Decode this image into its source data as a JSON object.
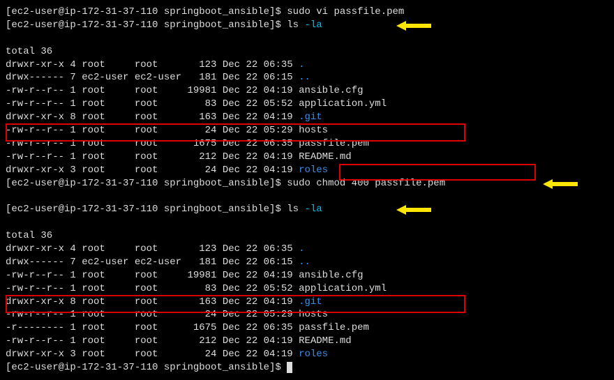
{
  "prompt_prefix": "[ec2-user@ip-172-31-37-110 springboot_ansible]$ ",
  "cmd1": "sudo vi passfile.pem",
  "cmd2_a": "ls ",
  "cmd2_b": "-la",
  "total": "total 36",
  "ls1": [
    {
      "perm": "drwxr-xr-x",
      "links": "4",
      "owner": "root    ",
      "group": "root    ",
      "size": "  123",
      "date": "Dec 22 06:35",
      "name": ".",
      "color": "dir-blue"
    },
    {
      "perm": "drwx------",
      "links": "7",
      "owner": "ec2-user",
      "group": "ec2-user",
      "size": "  181",
      "date": "Dec 22 06:15",
      "name": "..",
      "color": "dir-blue"
    },
    {
      "perm": "-rw-r--r--",
      "links": "1",
      "owner": "root    ",
      "group": "root    ",
      "size": "19981",
      "date": "Dec 22 04:19",
      "name": "ansible.cfg",
      "color": "file-white"
    },
    {
      "perm": "-rw-r--r--",
      "links": "1",
      "owner": "root    ",
      "group": "root    ",
      "size": "   83",
      "date": "Dec 22 05:52",
      "name": "application.yml",
      "color": "file-white"
    },
    {
      "perm": "drwxr-xr-x",
      "links": "8",
      "owner": "root    ",
      "group": "root    ",
      "size": "  163",
      "date": "Dec 22 04:19",
      "name": ".git",
      "color": "dir-blue"
    },
    {
      "perm": "-rw-r--r--",
      "links": "1",
      "owner": "root    ",
      "group": "root    ",
      "size": "   24",
      "date": "Dec 22 05:29",
      "name": "hosts",
      "color": "file-white"
    },
    {
      "perm": "-rw-r--r--",
      "links": "1",
      "owner": "root    ",
      "group": "root    ",
      "size": " 1675",
      "date": "Dec 22 06:35",
      "name": "passfile.pem",
      "color": "file-white"
    },
    {
      "perm": "-rw-r--r--",
      "links": "1",
      "owner": "root    ",
      "group": "root    ",
      "size": "  212",
      "date": "Dec 22 04:19",
      "name": "README.md",
      "color": "file-white"
    },
    {
      "perm": "drwxr-xr-x",
      "links": "3",
      "owner": "root    ",
      "group": "root    ",
      "size": "   24",
      "date": "Dec 22 04:19",
      "name": "roles",
      "color": "dir-blue"
    }
  ],
  "cmd3": "sudo chmod 400 passfile.pem",
  "ls2": [
    {
      "perm": "drwxr-xr-x",
      "links": "4",
      "owner": "root    ",
      "group": "root    ",
      "size": "  123",
      "date": "Dec 22 06:35",
      "name": ".",
      "color": "dir-blue"
    },
    {
      "perm": "drwx------",
      "links": "7",
      "owner": "ec2-user",
      "group": "ec2-user",
      "size": "  181",
      "date": "Dec 22 06:15",
      "name": "..",
      "color": "dir-blue"
    },
    {
      "perm": "-rw-r--r--",
      "links": "1",
      "owner": "root    ",
      "group": "root    ",
      "size": "19981",
      "date": "Dec 22 04:19",
      "name": "ansible.cfg",
      "color": "file-white"
    },
    {
      "perm": "-rw-r--r--",
      "links": "1",
      "owner": "root    ",
      "group": "root    ",
      "size": "   83",
      "date": "Dec 22 05:52",
      "name": "application.yml",
      "color": "file-white"
    },
    {
      "perm": "drwxr-xr-x",
      "links": "8",
      "owner": "root    ",
      "group": "root    ",
      "size": "  163",
      "date": "Dec 22 04:19",
      "name": ".git",
      "color": "dir-blue"
    },
    {
      "perm": "-rw-r--r--",
      "links": "1",
      "owner": "root    ",
      "group": "root    ",
      "size": "   24",
      "date": "Dec 22 05:29",
      "name": "hosts",
      "color": "file-white"
    },
    {
      "perm": "-r--------",
      "links": "1",
      "owner": "root    ",
      "group": "root    ",
      "size": " 1675",
      "date": "Dec 22 06:35",
      "name": "passfile.pem",
      "color": "file-white"
    },
    {
      "perm": "-rw-r--r--",
      "links": "1",
      "owner": "root    ",
      "group": "root    ",
      "size": "  212",
      "date": "Dec 22 04:19",
      "name": "README.md",
      "color": "file-white"
    },
    {
      "perm": "drwxr-xr-x",
      "links": "3",
      "owner": "root    ",
      "group": "root    ",
      "size": "   24",
      "date": "Dec 22 04:19",
      "name": "roles",
      "color": "dir-blue"
    }
  ]
}
